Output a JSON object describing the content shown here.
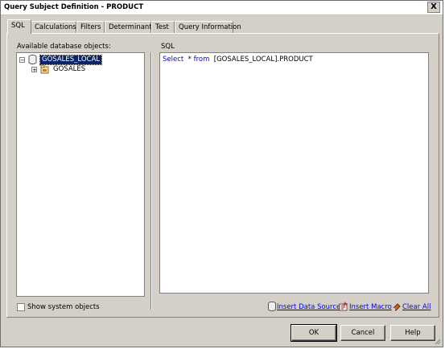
{
  "window": {
    "title": "Query Subject Definition - PRODUCT",
    "close_glyph": "X"
  },
  "tabs": [
    {
      "label": "SQL",
      "active": true
    },
    {
      "label": "Calculations",
      "active": false
    },
    {
      "label": "Filters",
      "active": false
    },
    {
      "label": "Determinants",
      "active": false
    },
    {
      "label": "Test",
      "active": false
    },
    {
      "label": "Query Information",
      "active": false
    }
  ],
  "left": {
    "heading": "Available database objects:",
    "tree": {
      "root": {
        "label": "GOSALES_LOCAL",
        "expander": "−",
        "icon": "database-icon",
        "selected": true
      },
      "child": {
        "label": "GOSALES",
        "expander": "+",
        "icon": "schema-icon"
      }
    },
    "show_system_objects": {
      "label": "Show system objects",
      "checked": false
    }
  },
  "right": {
    "heading": "SQL",
    "sql": {
      "keyword_select": "Select",
      "middle": "  *",
      "keyword_from": "from",
      "rest": "  [GOSALES_LOCAL].PRODUCT"
    },
    "links": [
      {
        "label": "Insert Data Source",
        "icon": "data-source-icon"
      },
      {
        "label": "Insert Macro",
        "icon": "macro-icon"
      },
      {
        "label": "Clear All",
        "icon": "eraser-icon"
      }
    ]
  },
  "buttons": {
    "ok": "OK",
    "cancel": "Cancel",
    "help": "Help"
  },
  "colors": {
    "dialog_bg": "#d4d0c8",
    "selection": "#0a246a",
    "link": "#0000ff",
    "keyword": "#0000ff"
  }
}
